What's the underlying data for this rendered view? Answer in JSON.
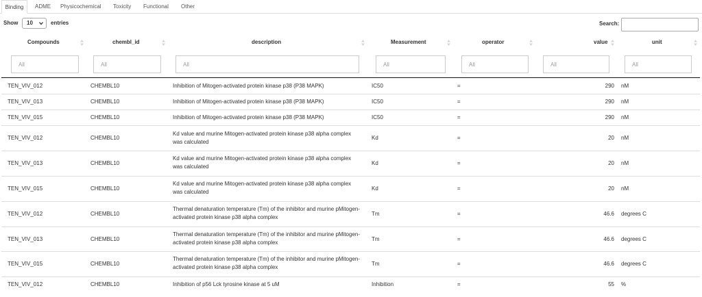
{
  "tabs": [
    {
      "label": "Binding",
      "active": true
    },
    {
      "label": "ADME",
      "active": false
    },
    {
      "label": "Physicochemical",
      "active": false
    },
    {
      "label": "Toxicity",
      "active": false
    },
    {
      "label": "Functional",
      "active": false
    },
    {
      "label": "Other",
      "active": false
    }
  ],
  "length": {
    "show_label": "Show",
    "value": "10",
    "entries_label": "entries"
  },
  "search": {
    "label": "Search:",
    "value": ""
  },
  "columns": [
    "Compounds",
    "chembl_id",
    "description",
    "Measurement",
    "operator",
    "value",
    "unit"
  ],
  "filters": {
    "placeholder": "All"
  },
  "rows": [
    {
      "compound": "TEN_VIV_012",
      "chembl_id": "CHEMBL10",
      "description": "Inhibition of Mitogen-activated protein kinase p38 (P38 MAPK)",
      "measurement": "IC50",
      "operator": "=",
      "value": "290",
      "unit": "nM"
    },
    {
      "compound": "TEN_VIV_013",
      "chembl_id": "CHEMBL10",
      "description": "Inhibition of Mitogen-activated protein kinase p38 (P38 MAPK)",
      "measurement": "IC50",
      "operator": "=",
      "value": "290",
      "unit": "nM"
    },
    {
      "compound": "TEN_VIV_015",
      "chembl_id": "CHEMBL10",
      "description": "Inhibition of Mitogen-activated protein kinase p38 (P38 MAPK)",
      "measurement": "IC50",
      "operator": "=",
      "value": "290",
      "unit": "nM"
    },
    {
      "compound": "TEN_VIV_012",
      "chembl_id": "CHEMBL10",
      "description": "Kd value and murine Mitogen-activated protein kinase p38 alpha complex was calculated",
      "measurement": "Kd",
      "operator": "=",
      "value": "20",
      "unit": "nM"
    },
    {
      "compound": "TEN_VIV_013",
      "chembl_id": "CHEMBL10",
      "description": "Kd value and murine Mitogen-activated protein kinase p38 alpha complex was calculated",
      "measurement": "Kd",
      "operator": "=",
      "value": "20",
      "unit": "nM"
    },
    {
      "compound": "TEN_VIV_015",
      "chembl_id": "CHEMBL10",
      "description": "Kd value and murine Mitogen-activated protein kinase p38 alpha complex was calculated",
      "measurement": "Kd",
      "operator": "=",
      "value": "20",
      "unit": "nM"
    },
    {
      "compound": "TEN_VIV_012",
      "chembl_id": "CHEMBL10",
      "description": "Thermal denaturation temperature (Tm) of the inhibitor and murine pMitogen-activated protein kinase p38 alpha complex",
      "measurement": "Tm",
      "operator": "=",
      "value": "46.6",
      "unit": "degrees C"
    },
    {
      "compound": "TEN_VIV_013",
      "chembl_id": "CHEMBL10",
      "description": "Thermal denaturation temperature (Tm) of the inhibitor and murine pMitogen-activated protein kinase p38 alpha complex",
      "measurement": "Tm",
      "operator": "=",
      "value": "46.6",
      "unit": "degrees C"
    },
    {
      "compound": "TEN_VIV_015",
      "chembl_id": "CHEMBL10",
      "description": "Thermal denaturation temperature (Tm) of the inhibitor and murine pMitogen-activated protein kinase p38 alpha complex",
      "measurement": "Tm",
      "operator": "=",
      "value": "46.6",
      "unit": "degrees C"
    },
    {
      "compound": "TEN_VIV_012",
      "chembl_id": "CHEMBL10",
      "description": "Inhibition of p56 Lck tyrosine kinase at 5 uM",
      "measurement": "Inhibition",
      "operator": "=",
      "value": "55",
      "unit": "%"
    }
  ]
}
